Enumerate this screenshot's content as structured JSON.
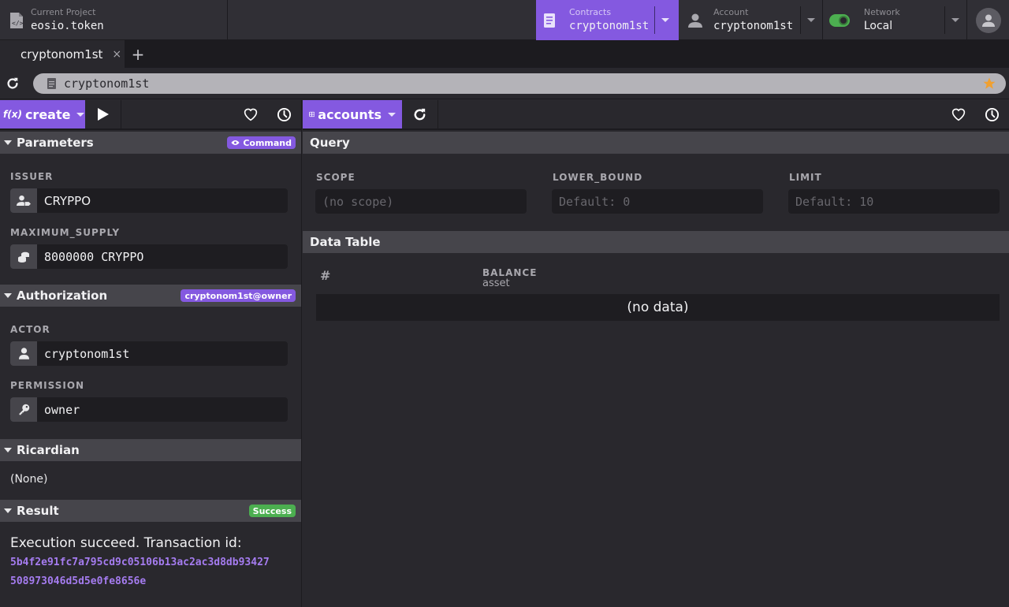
{
  "topbar": {
    "project_label": "Current Project",
    "project_value": "eosio.token",
    "contracts_label": "Contracts",
    "contracts_value": "cryptonom1st",
    "account_label": "Account",
    "account_value": "cryptonom1st",
    "network_label": "Network",
    "network_value": "Local",
    "network_enabled": true
  },
  "tabs": [
    {
      "label": "cryptonom1st",
      "active": true
    }
  ],
  "tab_add_label": "+",
  "tab_close_label": "×",
  "address": {
    "value": "cryptonom1st",
    "bookmarked": true
  },
  "colors": {
    "accent": "#8459e0",
    "success": "#4caf50",
    "star": "#f0a030",
    "toggle": "#4caf50"
  },
  "left": {
    "action_selector": {
      "prefix": "f(x)",
      "label": "create"
    },
    "parameters": {
      "title": "Parameters",
      "badge": "Command",
      "fields": [
        {
          "label": "ISSUER",
          "value": "CRYPPO",
          "icon": "user-tag-icon"
        },
        {
          "label": "MAXIMUM_SUPPLY",
          "value": "8000000 CRYPPO",
          "icon": "coins-icon"
        }
      ]
    },
    "authorization": {
      "title": "Authorization",
      "badge": "cryptonom1st@owner",
      "fields": [
        {
          "label": "ACTOR",
          "value": "cryptonom1st",
          "icon": "user-icon"
        },
        {
          "label": "PERMISSION",
          "value": "owner",
          "icon": "key-icon"
        }
      ]
    },
    "ricardian": {
      "title": "Ricardian",
      "content": "(None)"
    },
    "result": {
      "title": "Result",
      "badge": "Success",
      "message": "Execution succeed. Transaction id:",
      "txid_line1": "5b4f2e91fc7a795cd9c05106b13ac2ac3d8db93427",
      "txid_line2": "508973046d5d5e0fe8656e"
    }
  },
  "right": {
    "table_selector": {
      "label": "accounts"
    },
    "query": {
      "title": "Query",
      "fields": [
        {
          "label": "SCOPE",
          "placeholder": "(no scope)",
          "value": ""
        },
        {
          "label": "LOWER_BOUND",
          "placeholder": "Default: 0",
          "value": ""
        },
        {
          "label": "LIMIT",
          "placeholder": "Default: 10",
          "value": ""
        }
      ]
    },
    "data_table": {
      "title": "Data Table",
      "columns": [
        {
          "name": "#",
          "type": ""
        },
        {
          "name": "BALANCE",
          "type": "asset"
        }
      ],
      "rows": [],
      "empty_text": "(no data)"
    }
  }
}
